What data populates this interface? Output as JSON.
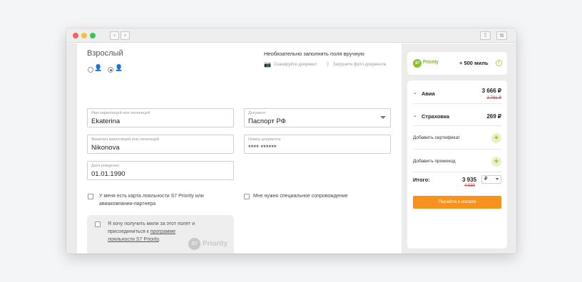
{
  "window": {
    "back_glyph": "‹",
    "forward_glyph": "›",
    "share_icon": "share-icon",
    "duplicate_icon": "duplicate-icon"
  },
  "passenger": {
    "section_title": "Взрослый",
    "optional_note": "Необязательно заполнять поля вручную",
    "scan_doc": "Сканируйте документ",
    "upload_photo": "Загрузите фото документа",
    "fields": {
      "first_name": {
        "label": "Имя кириллицей или латиницей",
        "value": "Ekaterina"
      },
      "last_name": {
        "label": "Фамилия кириллицей или латиницей",
        "value": "Nikonova"
      },
      "birth_date": {
        "label": "Дата рождения",
        "value": "01.01.1990"
      },
      "document": {
        "label": "Документ",
        "value": "Паспорт РФ"
      },
      "document_number": {
        "label": "Номер документа",
        "value": "**** ******"
      }
    },
    "loyalty_checkbox": "У меня есть карта лояльности S7 Priority или авиакомпании-партнера",
    "support_checkbox": "Мне нужно специальное  сопровождение",
    "miles_offer": {
      "text_start": "Я хочу получить мили за этот полет и присоединиться к ",
      "link": "программе лояльности S7 Priority",
      "text_end": ".",
      "brand_badge": "S7",
      "brand_word": "Priority"
    }
  },
  "sidebar": {
    "priority": {
      "badge": "S7",
      "label": "Priority",
      "miles": "+ 500 миль",
      "info": "i"
    },
    "summary": {
      "avia": {
        "label": "Авиа",
        "price": "3 666 ₽",
        "old_price": "3 761 ₽"
      },
      "insurance": {
        "label": "Страховка",
        "price": "269 ₽"
      },
      "add_certificate": "Добавить сертификат",
      "add_promo": "Добавить промокод",
      "total_label": "Итого:",
      "total_value": "3 935",
      "total_old": "4 030",
      "currency": "₽",
      "pay_button": "Перейти к оплате"
    }
  },
  "colors": {
    "accent_orange": "#f7931d",
    "priority_green": "#8cbf2b",
    "old_price_red": "#d03c3c"
  }
}
